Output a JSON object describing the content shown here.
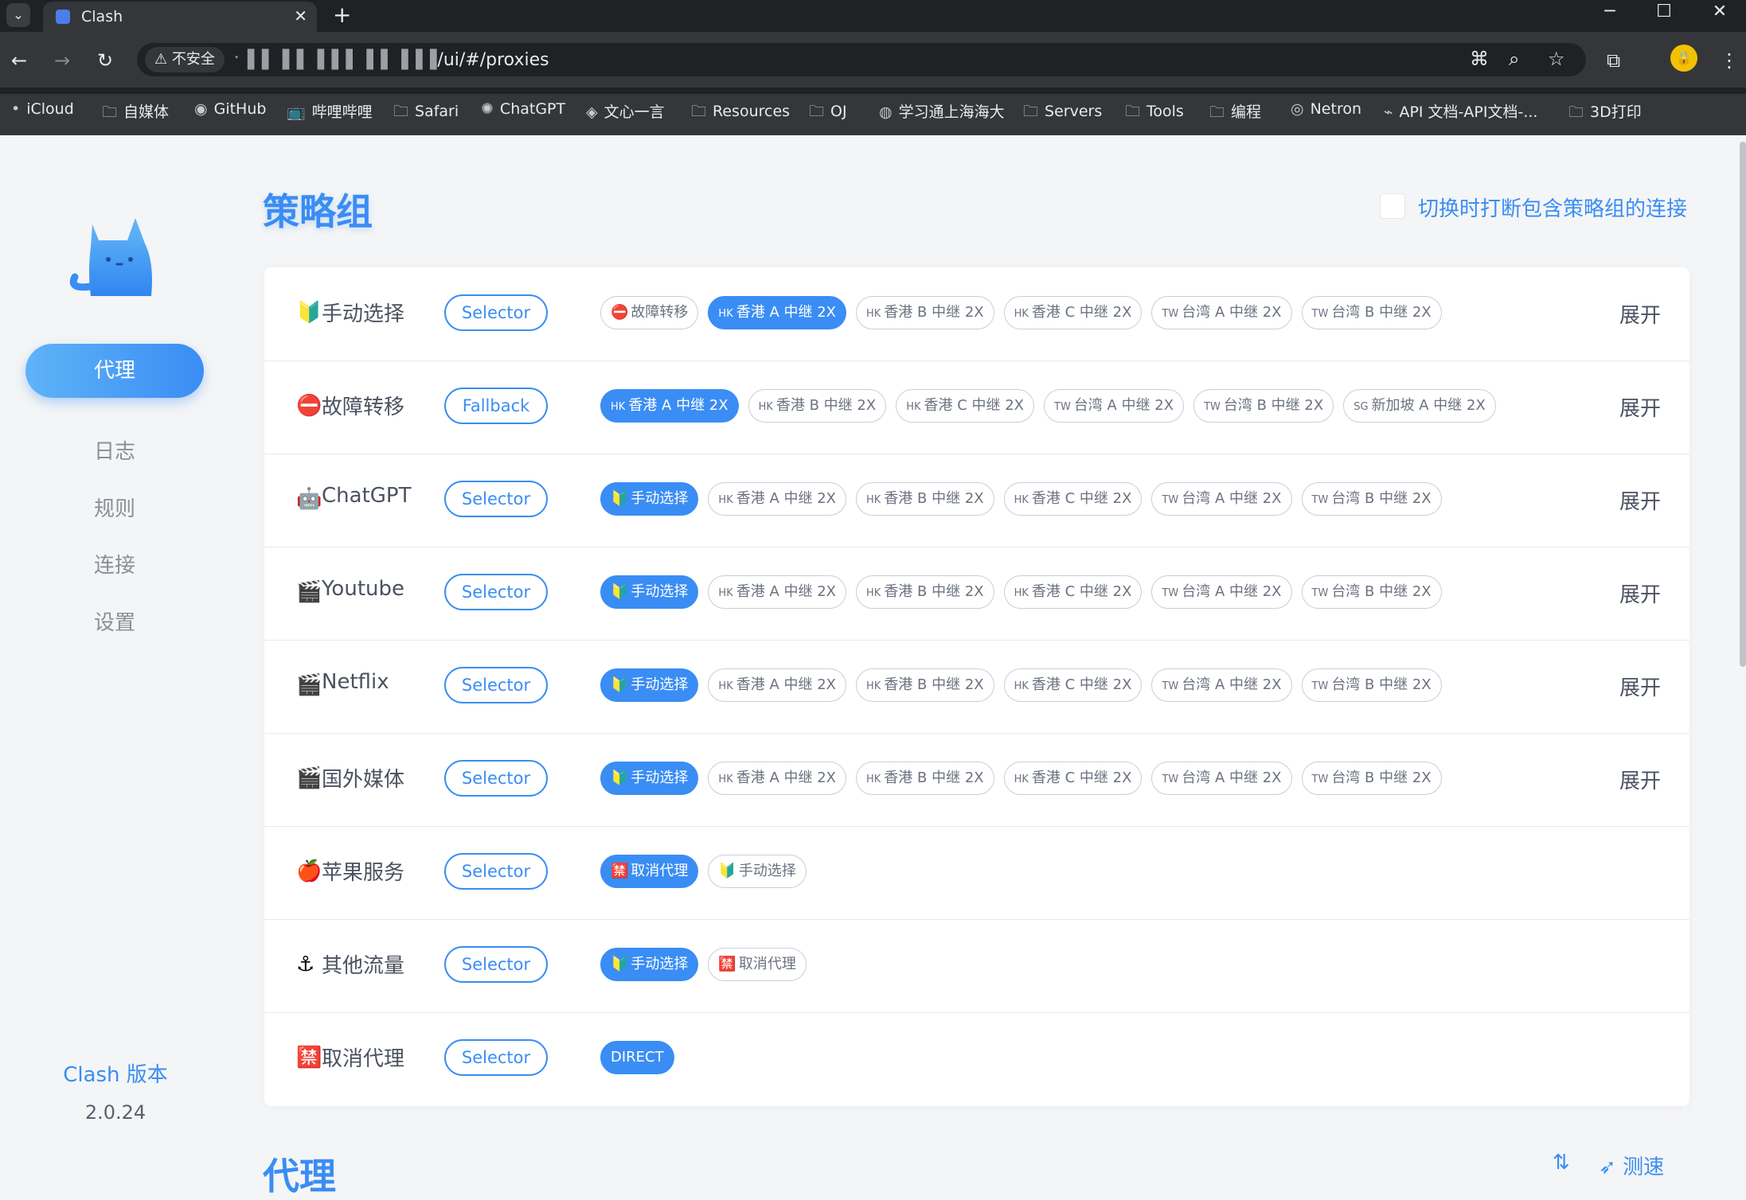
{
  "browser": {
    "tab_title": "Clash",
    "new_tab": "+",
    "security_label": "不安全",
    "url_obscured": "ˑ▐▐ ▐▐ ▐▐▐ ▐▐ ▐▐▐",
    "url_path": "/ui/#/proxies",
    "bookmarks": [
      {
        "label": "iCloud",
        "icon": "apple-icon"
      },
      {
        "label": "自媒体",
        "icon": "folder-icon"
      },
      {
        "label": "GitHub",
        "icon": "github-icon"
      },
      {
        "label": "哔哩哔哩",
        "icon": "bilibili-icon"
      },
      {
        "label": "Safari",
        "icon": "folder-icon"
      },
      {
        "label": "ChatGPT",
        "icon": "chatgpt-icon"
      },
      {
        "label": "文心一言",
        "icon": "wenxin-icon"
      },
      {
        "label": "Resources",
        "icon": "folder-icon"
      },
      {
        "label": "OJ",
        "icon": "folder-icon"
      },
      {
        "label": "学习通上海海大",
        "icon": "globe-icon"
      },
      {
        "label": "Servers",
        "icon": "folder-icon"
      },
      {
        "label": "Tools",
        "icon": "folder-icon"
      },
      {
        "label": "编程",
        "icon": "folder-icon"
      },
      {
        "label": "Netron",
        "icon": "netron-icon"
      },
      {
        "label": "API 文档-API文档-...",
        "icon": "api-icon"
      },
      {
        "label": "3D打印",
        "icon": "folder-icon"
      }
    ]
  },
  "sidebar": {
    "nav": [
      {
        "label": "代理",
        "active": true
      },
      {
        "label": "日志"
      },
      {
        "label": "规则"
      },
      {
        "label": "连接"
      },
      {
        "label": "设置"
      }
    ],
    "version_title": "Clash 版本",
    "version": "2.0.24"
  },
  "main": {
    "title": "策略组",
    "toggle_label": "切换时打断包含策略组的连接",
    "expand_label": "展开",
    "groups": [
      {
        "name": "手动选择",
        "icon": "🔰",
        "type": "Selector",
        "proxies": [
          {
            "code": "",
            "icon": "⛔",
            "label": "故障转移",
            "selected": false
          },
          {
            "code": "HK",
            "label": "香港 A 中继 2X",
            "selected": true
          },
          {
            "code": "HK",
            "label": "香港 B 中继 2X",
            "selected": false
          },
          {
            "code": "HK",
            "label": "香港 C 中继 2X",
            "selected": false
          },
          {
            "code": "TW",
            "label": "台湾 A 中继 2X",
            "selected": false
          },
          {
            "code": "TW",
            "label": "台湾 B 中继 2X",
            "selected": false
          }
        ],
        "expand": true
      },
      {
        "name": "故障转移",
        "icon": "⛔",
        "type": "Fallback",
        "proxies": [
          {
            "code": "HK",
            "label": "香港 A 中继 2X",
            "selected": true
          },
          {
            "code": "HK",
            "label": "香港 B 中继 2X",
            "selected": false
          },
          {
            "code": "HK",
            "label": "香港 C 中继 2X",
            "selected": false
          },
          {
            "code": "TW",
            "label": "台湾 A 中继 2X",
            "selected": false
          },
          {
            "code": "TW",
            "label": "台湾 B 中继 2X",
            "selected": false
          },
          {
            "code": "SG",
            "label": "新加坡 A 中继 2X",
            "selected": false
          }
        ],
        "expand": true
      },
      {
        "name": "ChatGPT",
        "icon": "🤖",
        "type": "Selector",
        "proxies": [
          {
            "code": "",
            "icon": "🔰",
            "label": "手动选择",
            "selected": true
          },
          {
            "code": "HK",
            "label": "香港 A 中继 2X",
            "selected": false
          },
          {
            "code": "HK",
            "label": "香港 B 中继 2X",
            "selected": false
          },
          {
            "code": "HK",
            "label": "香港 C 中继 2X",
            "selected": false
          },
          {
            "code": "TW",
            "label": "台湾 A 中继 2X",
            "selected": false
          },
          {
            "code": "TW",
            "label": "台湾 B 中继 2X",
            "selected": false
          }
        ],
        "expand": true
      },
      {
        "name": "Youtube",
        "icon": "🎬",
        "type": "Selector",
        "proxies": [
          {
            "code": "",
            "icon": "🔰",
            "label": "手动选择",
            "selected": true
          },
          {
            "code": "HK",
            "label": "香港 A 中继 2X",
            "selected": false
          },
          {
            "code": "HK",
            "label": "香港 B 中继 2X",
            "selected": false
          },
          {
            "code": "HK",
            "label": "香港 C 中继 2X",
            "selected": false
          },
          {
            "code": "TW",
            "label": "台湾 A 中继 2X",
            "selected": false
          },
          {
            "code": "TW",
            "label": "台湾 B 中继 2X",
            "selected": false
          }
        ],
        "expand": true
      },
      {
        "name": "Netflix",
        "icon": "🎬",
        "type": "Selector",
        "proxies": [
          {
            "code": "",
            "icon": "🔰",
            "label": "手动选择",
            "selected": true
          },
          {
            "code": "HK",
            "label": "香港 A 中继 2X",
            "selected": false
          },
          {
            "code": "HK",
            "label": "香港 B 中继 2X",
            "selected": false
          },
          {
            "code": "HK",
            "label": "香港 C 中继 2X",
            "selected": false
          },
          {
            "code": "TW",
            "label": "台湾 A 中继 2X",
            "selected": false
          },
          {
            "code": "TW",
            "label": "台湾 B 中继 2X",
            "selected": false
          }
        ],
        "expand": true
      },
      {
        "name": "国外媒体",
        "icon": "🎬",
        "type": "Selector",
        "proxies": [
          {
            "code": "",
            "icon": "🔰",
            "label": "手动选择",
            "selected": true
          },
          {
            "code": "HK",
            "label": "香港 A 中继 2X",
            "selected": false
          },
          {
            "code": "HK",
            "label": "香港 B 中继 2X",
            "selected": false
          },
          {
            "code": "HK",
            "label": "香港 C 中继 2X",
            "selected": false
          },
          {
            "code": "TW",
            "label": "台湾 A 中继 2X",
            "selected": false
          },
          {
            "code": "TW",
            "label": "台湾 B 中继 2X",
            "selected": false
          }
        ],
        "expand": true
      },
      {
        "name": "苹果服务",
        "icon": "🍎",
        "type": "Selector",
        "proxies": [
          {
            "code": "",
            "icon": "🈲",
            "label": "取消代理",
            "selected": true
          },
          {
            "code": "",
            "icon": "🔰",
            "label": "手动选择",
            "selected": false
          }
        ],
        "expand": false
      },
      {
        "name": "其他流量",
        "icon": "⚓",
        "type": "Selector",
        "proxies": [
          {
            "code": "",
            "icon": "🔰",
            "label": "手动选择",
            "selected": true
          },
          {
            "code": "",
            "icon": "🈲",
            "label": "取消代理",
            "selected": false
          }
        ],
        "expand": false
      },
      {
        "name": "取消代理",
        "icon": "🈲",
        "type": "Selector",
        "proxies": [
          {
            "code": "",
            "label": "DIRECT",
            "selected": true
          }
        ],
        "expand": false
      }
    ]
  },
  "section2": {
    "title": "代理",
    "sort_icon": "sort-icon",
    "test_label": "测速"
  },
  "colors": {
    "accent": "#3a8df4",
    "chrome_bg": "#202124",
    "page_bg": "#f4f5f6"
  }
}
